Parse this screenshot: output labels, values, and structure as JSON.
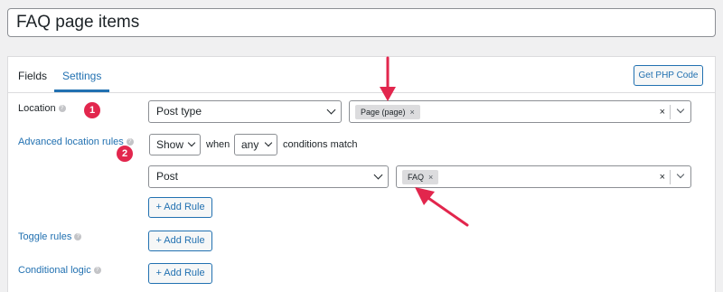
{
  "title": "FAQ page items",
  "tabs": [
    {
      "label": "Fields"
    },
    {
      "label": "Settings"
    }
  ],
  "php_button": "Get PHP Code",
  "location": {
    "label": "Location",
    "type_select": "Post type",
    "tag": "Page (page)"
  },
  "advanced": {
    "label": "Advanced location rules",
    "show_select": "Show",
    "when_text": "when",
    "any_select": "any",
    "conditions_text": "conditions match",
    "post_select": "Post",
    "tag": "FAQ",
    "add_rule": "+ Add Rule"
  },
  "toggle": {
    "label": "Toggle rules",
    "add_rule": "+ Add Rule"
  },
  "conditional": {
    "label": "Conditional logic",
    "add_rule": "+ Add Rule"
  },
  "badges": [
    "1",
    "2"
  ],
  "help_icon": "?",
  "tag_remove": "×",
  "clear_icon": "×",
  "colors": {
    "accent": "#2271b1",
    "annotation": "#e2264d",
    "panel_bg": "#ffffff",
    "page_bg": "#f0f0f1"
  }
}
